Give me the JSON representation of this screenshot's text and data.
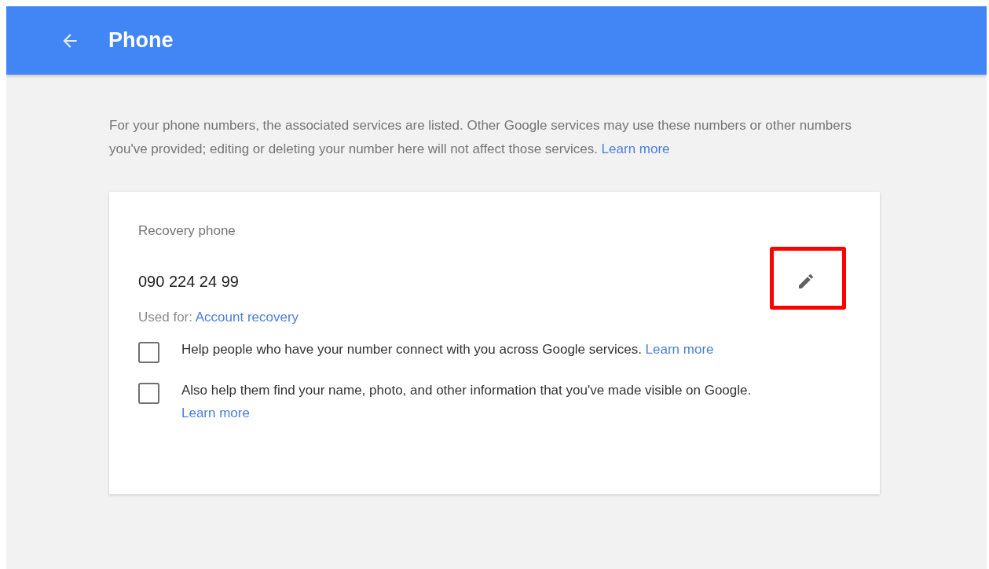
{
  "header": {
    "title": "Phone"
  },
  "intro": {
    "text": "For your phone numbers, the associated services are listed. Other Google services may use these numbers or other numbers you've provided; editing or deleting your number here will not affect those services.",
    "link": "Learn more"
  },
  "card": {
    "label": "Recovery phone",
    "number": "090 224 24 99",
    "used_for_label": "Used for:",
    "used_for_link": "Account recovery",
    "options": [
      {
        "text": "Help people who have your number connect with you across Google services.",
        "link": "Learn more",
        "checked": false
      },
      {
        "text": "Also help them find your name, photo, and other information that you've made visible on Google.",
        "link": "Learn more",
        "checked": false
      }
    ]
  }
}
